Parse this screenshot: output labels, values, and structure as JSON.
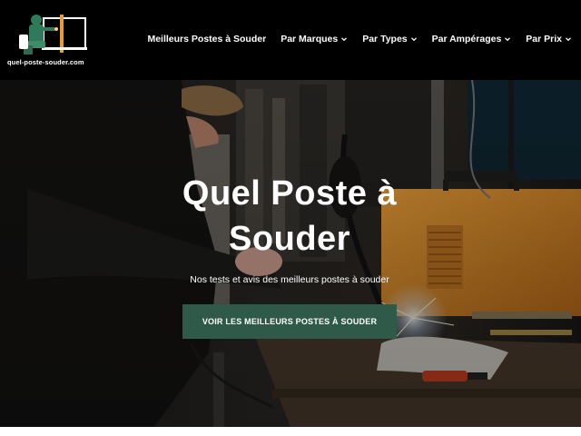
{
  "header": {
    "logo_text": "quel-poste-souder.com",
    "nav": [
      {
        "label": "Meilleurs Postes à Souder",
        "has_dropdown": false
      },
      {
        "label": "Par Marques",
        "has_dropdown": true
      },
      {
        "label": "Par Types",
        "has_dropdown": true
      },
      {
        "label": "Par Ampérages",
        "has_dropdown": true
      },
      {
        "label": "Par Prix",
        "has_dropdown": true
      }
    ]
  },
  "hero": {
    "title": "Quel Poste à Souder",
    "subtitle": "Nos tests et avis des meilleurs postes à souder",
    "cta_label": "VOIR LES MEILLEURS POSTES À SOUDER"
  },
  "colors": {
    "header_bg": "#000000",
    "cta_bg": "#2f5a4a",
    "machine_orange": "#e2922a"
  }
}
